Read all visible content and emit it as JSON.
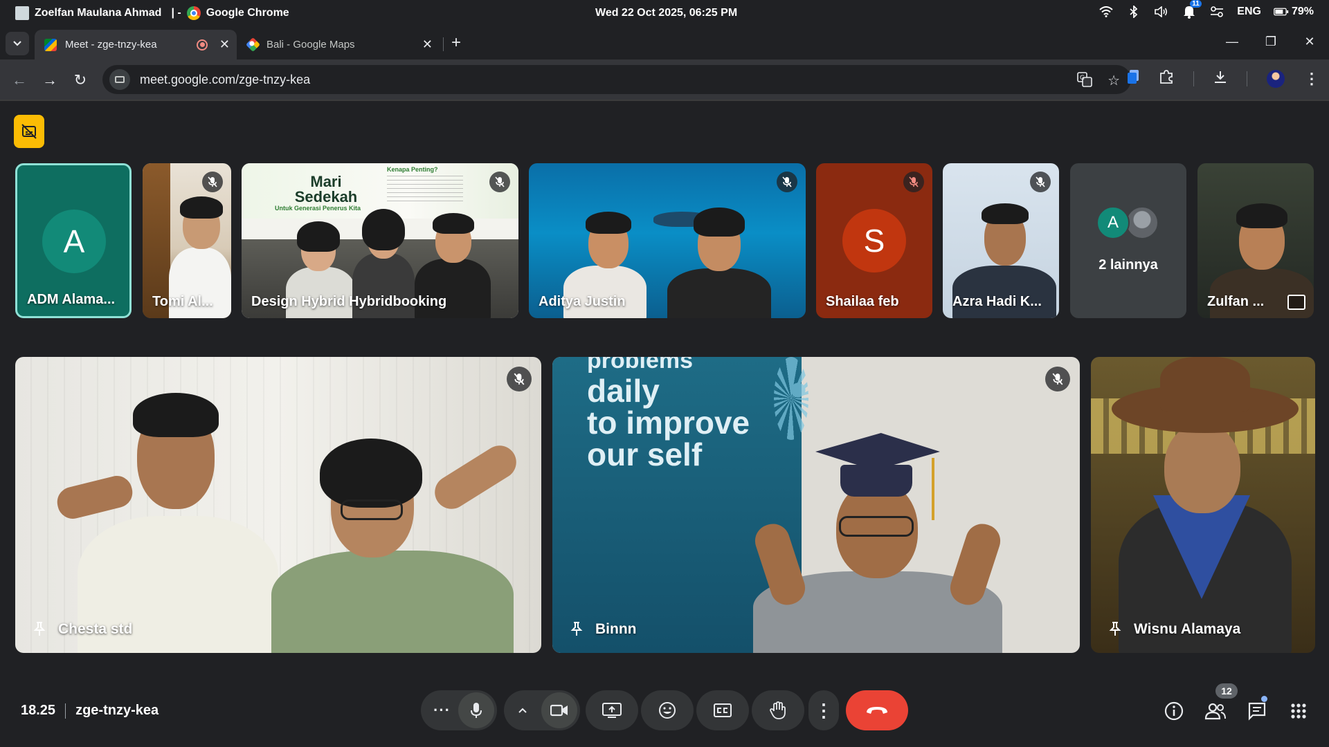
{
  "os": {
    "window_title_user": "Zoelfan Maulana Ahmad",
    "window_title_sep": "| -",
    "window_title_app": "Google Chrome",
    "clock": "Wed 22 Oct 2025, 06:25 PM",
    "notification_count": "11",
    "language": "ENG",
    "battery": "79%"
  },
  "tabs": [
    {
      "title": "Meet - zge-tnzy-kea",
      "active": true,
      "recording": true
    },
    {
      "title": "Bali - Google Maps",
      "active": false
    }
  ],
  "toolbar": {
    "url": "meet.google.com/zge-tnzy-kea"
  },
  "strip": [
    {
      "name": "ADM Alama...",
      "type": "avatar",
      "initial": "A",
      "color": "#0f7b6c",
      "muted": false,
      "speaking": true
    },
    {
      "name": "Tomi Al...",
      "type": "video",
      "muted": true
    },
    {
      "name": "Design Hybrid Hybridbooking",
      "type": "video",
      "muted": true,
      "poster_title": "Mari Sedekah",
      "poster_sub": "Untuk Generasi Penerus Kita",
      "poster_right": "Kenapa Penting?"
    },
    {
      "name": "Aditya Justin",
      "type": "video",
      "muted": true
    },
    {
      "name": "Shailaa feb",
      "type": "avatar",
      "initial": "S",
      "color": "#c1360f",
      "muted": true
    },
    {
      "name": "Azra Hadi K...",
      "type": "video",
      "muted": true
    },
    {
      "name": "2 lainnya",
      "type": "others",
      "initial": "A"
    },
    {
      "name": "Zulfan ...",
      "type": "video",
      "muted": false
    }
  ],
  "main": [
    {
      "name": "Chesta std",
      "muted": true
    },
    {
      "name": "Binnn",
      "muted": true,
      "banner_text": [
        "problems",
        "daily",
        "to improve",
        "our self"
      ]
    },
    {
      "name": "Wisnu Alamaya",
      "muted": false
    }
  ],
  "footer": {
    "time": "18.25",
    "meeting_code": "zge-tnzy-kea",
    "participant_count": "12"
  },
  "colors": {
    "background": "#202124",
    "control": "#333537",
    "end_call": "#ea4335",
    "caption_badge": "#fbbc04",
    "speaking_ring": "#8fe1d6"
  }
}
